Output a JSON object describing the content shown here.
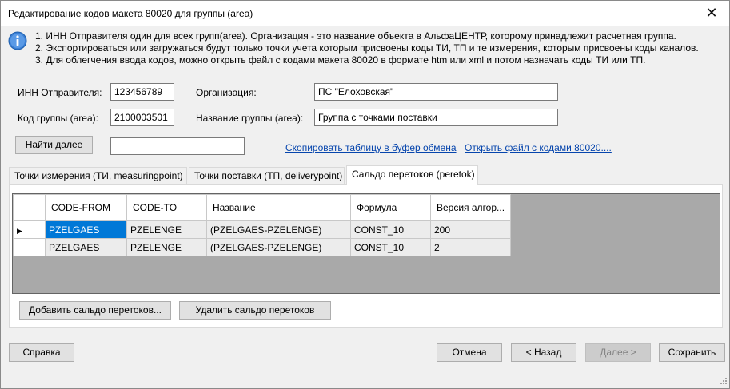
{
  "window": {
    "title": "Редактирование кодов макета 80020 для группы (area)",
    "close_glyph": "✕"
  },
  "info": {
    "icon": "info-icon",
    "lines": [
      "1. ИНН Отправителя один для всех групп(area). Организация - это название объекта в АльфаЦЕНТР, которому принадлежит расчетная группа.",
      "2. Экспортироваться или загружаться будут только точки учета которым присвоены коды ТИ, ТП и те измерения, которым присвоены коды каналов.",
      "3. Для облегчения ввода кодов, можно открыть файл с кодами макета 80020 в формате htm или xml и потом назначать коды ТИ или ТП."
    ]
  },
  "form": {
    "inn_label": "ИНН Отправителя:",
    "inn_value": "123456789",
    "org_label": "Организация:",
    "org_value": "ПС \"Елоховская\"",
    "code_label": "Код группы (area):",
    "code_value": "2100003501",
    "name_label": "Название группы (area):",
    "name_value": "Группа с точками поставки",
    "find_button": "Найти далее",
    "find_value": "",
    "copy_link": "Скопировать таблицу в буфер обмена",
    "open_link": "Открыть файл с кодами 80020...."
  },
  "tabs": [
    {
      "label": "Точки измерения (ТИ, measuringpoint)",
      "active": false
    },
    {
      "label": "Точки поставки (ТП, deliverypoint)",
      "active": false
    },
    {
      "label": "Сальдо перетоков (peretok)",
      "active": true
    }
  ],
  "grid": {
    "columns": [
      "CODE-FROM",
      "CODE-TO",
      "Название",
      "Формула",
      "Версия алгор..."
    ],
    "current_row_glyph": "▶",
    "rows": [
      [
        "PZELGAES",
        "PZELENGE",
        "(PZELGAES-PZELENGE)",
        "CONST_10",
        "200"
      ],
      [
        "PZELGAES",
        "PZELENGE",
        "(PZELGAES-PZELENGE)",
        "CONST_10",
        "2"
      ]
    ]
  },
  "panel_buttons": {
    "add": "Добавить сальдо перетоков...",
    "delete": "Удалить сальдо перетоков"
  },
  "footer": {
    "help": "Справка",
    "cancel": "Отмена",
    "back": "< Назад",
    "next": "Далее >",
    "save": "Сохранить"
  },
  "colors": {
    "selection": "#0078d7",
    "link": "#0645ad",
    "grid_background": "#a9a9a9"
  }
}
